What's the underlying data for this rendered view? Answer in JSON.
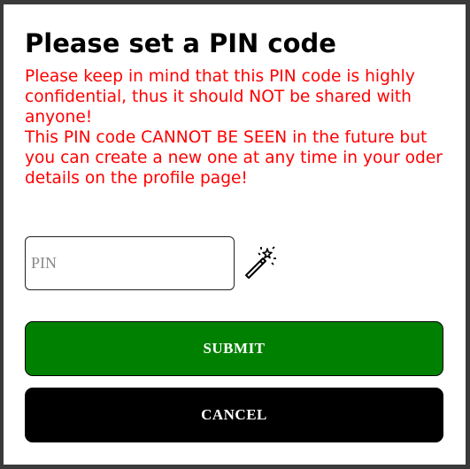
{
  "dialog": {
    "title": "Please set a PIN code",
    "warning_line_1": "Please keep in mind that this PIN code is highly confidential, thus it should NOT be shared with anyone!",
    "warning_line_2": "This PIN code CANNOT BE SEEN in the future but you can create a new one at any time in your oder details on the profile page!",
    "pin_placeholder": "PIN",
    "pin_value": "",
    "generate_icon": "magic-wand-icon",
    "submit_label": "SUBMIT",
    "cancel_label": "CANCEL"
  },
  "colors": {
    "warning_text": "#ff0000",
    "submit_bg": "#008000",
    "cancel_bg": "#000000"
  }
}
